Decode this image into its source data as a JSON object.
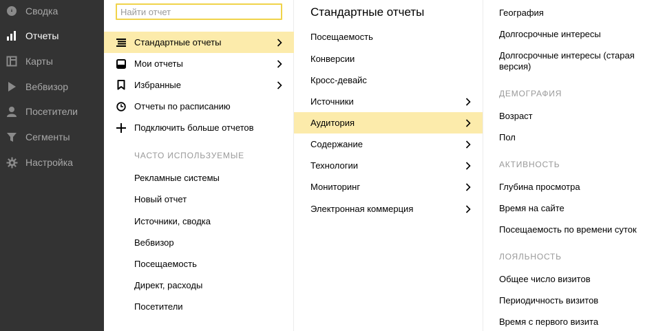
{
  "sidebar": {
    "items": [
      {
        "label": "Сводка",
        "icon": "dashboard-icon",
        "active": false
      },
      {
        "label": "Отчеты",
        "icon": "bar-chart-icon",
        "active": true
      },
      {
        "label": "Карты",
        "icon": "map-icon",
        "active": false
      },
      {
        "label": "Вебвизор",
        "icon": "play-icon",
        "active": false
      },
      {
        "label": "Посетители",
        "icon": "person-icon",
        "active": false
      },
      {
        "label": "Сегменты",
        "icon": "filter-icon",
        "active": false
      },
      {
        "label": "Настройка",
        "icon": "gear-icon",
        "active": false
      }
    ]
  },
  "col1": {
    "search_placeholder": "Найти отчет",
    "menu": [
      {
        "label": "Стандартные отчеты",
        "icon": "list-icon",
        "chevron": true,
        "active": true
      },
      {
        "label": "Мои отчеты",
        "icon": "inbox-icon",
        "chevron": true,
        "active": false
      },
      {
        "label": "Избранные",
        "icon": "bookmark-icon",
        "chevron": true,
        "active": false
      },
      {
        "label": "Отчеты по расписанию",
        "icon": "clock-icon",
        "chevron": false,
        "active": false
      },
      {
        "label": "Подключить больше отчетов",
        "icon": "plus-icon",
        "chevron": false,
        "active": false
      }
    ],
    "frequent_title": "ЧАСТО ИСПОЛЬЗУЕМЫЕ",
    "frequent": [
      "Рекламные системы",
      "Новый отчет",
      "Источники, сводка",
      "Вебвизор",
      "Посещаемость",
      "Директ, расходы",
      "Посетители"
    ]
  },
  "col2": {
    "title": "Стандартные отчеты",
    "items": [
      {
        "label": "Посещаемость",
        "chevron": false,
        "active": false
      },
      {
        "label": "Конверсии",
        "chevron": false,
        "active": false
      },
      {
        "label": "Кросс-девайс",
        "chevron": false,
        "active": false
      },
      {
        "label": "Источники",
        "chevron": true,
        "active": false
      },
      {
        "label": "Аудитория",
        "chevron": true,
        "active": true
      },
      {
        "label": "Содержание",
        "chevron": true,
        "active": false
      },
      {
        "label": "Технологии",
        "chevron": true,
        "active": false
      },
      {
        "label": "Мониторинг",
        "chevron": true,
        "active": false
      },
      {
        "label": "Электронная коммерция",
        "chevron": true,
        "active": false
      }
    ]
  },
  "col3": {
    "geo": "География",
    "long_interests": "Долгосрочные интересы",
    "long_interests_old_1": "Долгосрочные интересы (старая",
    "long_interests_old_2": "версия)",
    "demography_title": "ДЕМОГРАФИЯ",
    "age": "Возраст",
    "gender": "Пол",
    "activity_title": "АКТИВНОСТЬ",
    "depth": "Глубина просмотра",
    "time_on_site": "Время на сайте",
    "traffic_by_time": "Посещаемость по времени суток",
    "loyalty_title": "ЛОЯЛЬНОСТЬ",
    "total_visits": "Общее число визитов",
    "visit_periodicity": "Периодичность визитов",
    "time_since_first": "Время с первого визита"
  },
  "colors": {
    "sidebar_bg": "#333333",
    "highlight": "#fcebab",
    "search_border": "#f0d34a"
  }
}
